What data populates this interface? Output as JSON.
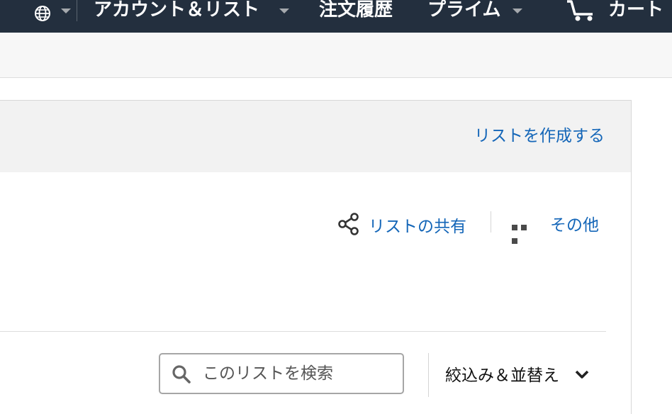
{
  "nav": {
    "account_lists": "アカウント＆リスト",
    "orders": "注文履歴",
    "prime": "プライム",
    "cart": "カート",
    "icons": {
      "globe": "globe-icon",
      "cart": "cart-icon",
      "caret": "chevron-down-icon"
    }
  },
  "lists_header": {
    "create_list": "リストを作成する"
  },
  "list_actions": {
    "share": "リストの共有",
    "more": "その他"
  },
  "list_toolbar": {
    "search_placeholder": "このリストを検索",
    "search_value": "",
    "filter_sort": "絞込み＆並替え"
  },
  "colors": {
    "nav_bg": "#232f3e",
    "link": "#1466b8",
    "panel_bg": "#f2f2f2"
  }
}
